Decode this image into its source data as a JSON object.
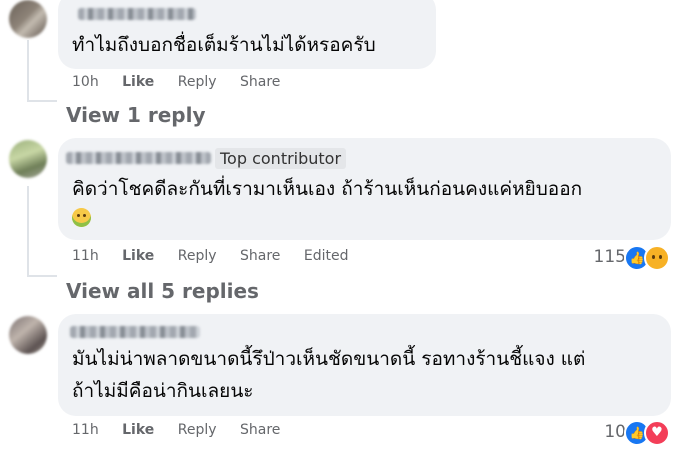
{
  "comments": [
    {
      "text_lines": [
        "ทำไมถึงบอกชื่อเต็มร้านไม่ได้หรอครับ"
      ],
      "time": "10h",
      "like_label": "Like",
      "reply_label": "Reply",
      "share_label": "Share"
    },
    {
      "badge": "Top contributor",
      "text_lines": [
        "คิดว่าโชคดีละกันที่เรามาเห็นเอง ถ้าร้านเห็นก่อนคงแค่หยิบออก"
      ],
      "time": "11h",
      "like_label": "Like",
      "reply_label": "Reply",
      "share_label": "Share",
      "edited_label": "Edited",
      "reaction_count": "115",
      "reactions": [
        "like-icon",
        "sad-icon"
      ]
    },
    {
      "text_lines": [
        "มันไม่น่าพลาดขนาดนี้รึป่าวเห็นชัดขนาดนี้ รอทางร้านชี้แจง แต่",
        "ถ้าไม่มีคือน่ากินเลยนะ"
      ],
      "time": "11h",
      "like_label": "Like",
      "reply_label": "Reply",
      "share_label": "Share",
      "reaction_count": "10",
      "reactions": [
        "like-icon",
        "love-icon"
      ]
    }
  ],
  "view_replies": [
    "View 1 reply",
    "View all 5 replies"
  ],
  "colors": {
    "bubble": "#f0f2f5",
    "meta_text": "#65676b",
    "like_blue": "#1877f2",
    "love_red": "#f33e58"
  }
}
